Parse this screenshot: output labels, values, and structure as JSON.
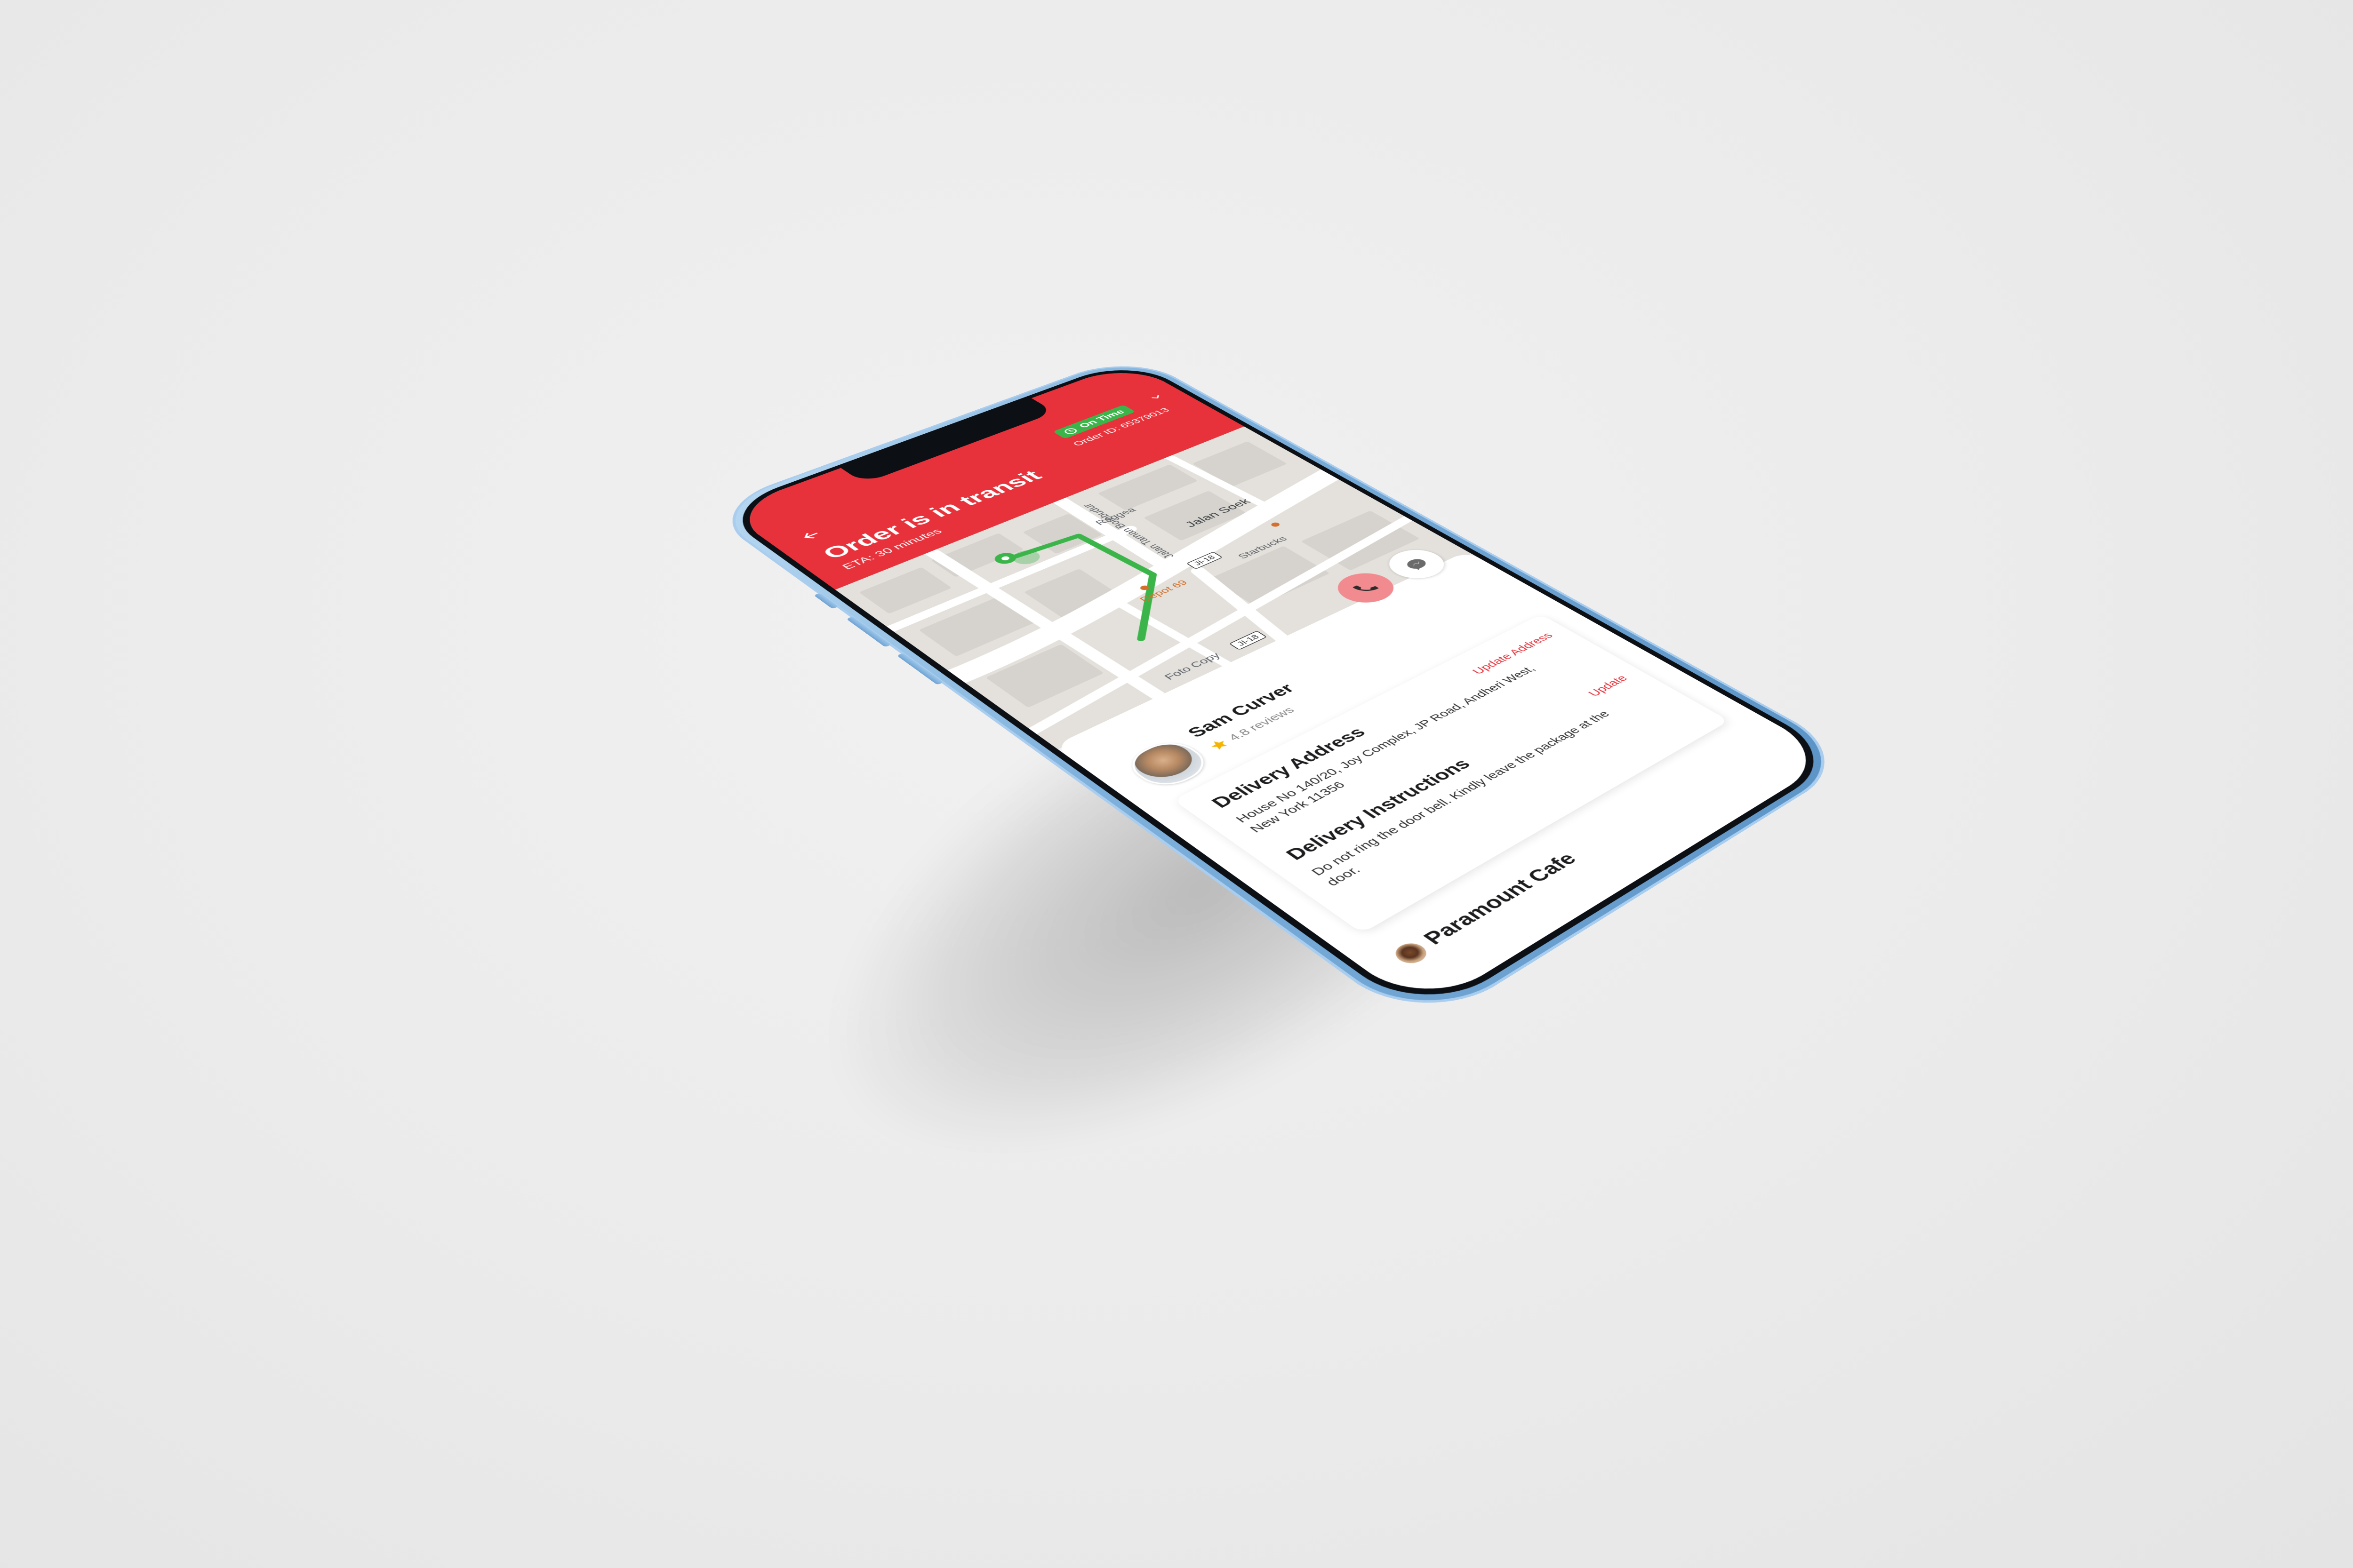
{
  "header": {
    "title": "Order is in transit",
    "eta": "ETA: 30 minutes",
    "status_badge": "On Time",
    "order_id": "Order ID: 65379013"
  },
  "map": {
    "labels": {
      "street_main": "Jalan Soek",
      "street_vertical": "Jalan Taman Borobudur",
      "poi_raggea": "Raggea",
      "poi_depot": "Depot 69",
      "poi_starbucks": "Starbucks",
      "poi_foto": "Foto Copy",
      "road_1": "JI-18",
      "road_2": "JI-18"
    },
    "route_color": "#3bb54a"
  },
  "driver": {
    "name": "Sam Curver",
    "reviews": "4.8 reviews"
  },
  "delivery_address": {
    "title": "Delivery Address",
    "body": "House No 140/20, Joy Complex, JP Road, Andheri West, New York 11356",
    "action": "Update Address"
  },
  "delivery_instructions": {
    "title": "Delivery Instructions",
    "body": "Do not ring the door bell. Kindly leave the package at the door.",
    "action": "Update"
  },
  "restaurant": {
    "name": "Paramount Cafe"
  },
  "colors": {
    "brand_red": "#e8323b",
    "on_time_green": "#3bb54a",
    "phone_blue": "#7fb1dc"
  },
  "icons": [
    "back-arrow-icon",
    "clock-icon",
    "chevron-down-icon",
    "phone-icon",
    "message-icon",
    "star-icon",
    "pin-icon"
  ]
}
